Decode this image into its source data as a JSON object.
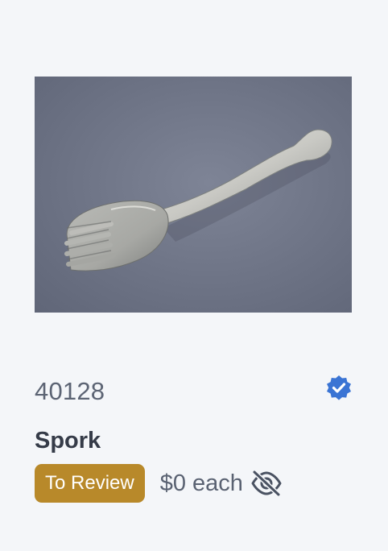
{
  "item": {
    "id": "40128",
    "name": "Spork",
    "status_label": "To Review",
    "price": "$0 each",
    "image_alt": "Spork"
  },
  "icons": {
    "verified": "verified-badge-icon",
    "visibility": "eye-slash-icon"
  },
  "colors": {
    "page_background": "#f4f6f9",
    "status_badge": "#b8892a",
    "verified": "#3a74d4",
    "text_primary": "#353b48",
    "text_secondary": "#5c6474"
  }
}
